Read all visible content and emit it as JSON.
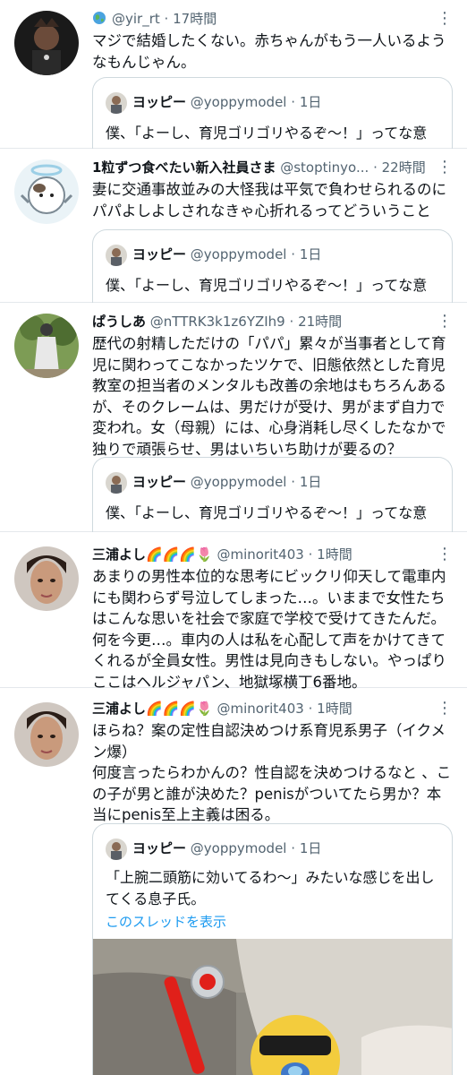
{
  "tweets": [
    {
      "author_name": "",
      "author_prefix_icon": "globe-icon",
      "handle": "@yir_rt",
      "time": "17時間",
      "text": "マジで結婚したくない。赤ちゃんがもう一人いるようなもんじゃん。",
      "quote": {
        "name": "ヨッピー",
        "handle": "@yoppymodel",
        "time": "1日",
        "text": "僕、「よーし、育児ゴリゴリやるぞ〜！」ってな意"
      }
    },
    {
      "author_name": "1粒ずつ食べたい新入社員さま",
      "handle": "@stoptinyo...",
      "time": "22時間",
      "text": "妻に交通事故並みの大怪我は平気で負わせられるのにパパよしよしされなきゃ心折れるってどういうこと",
      "quote": {
        "name": "ヨッピー",
        "handle": "@yoppymodel",
        "time": "1日",
        "text": "僕、「よーし、育児ゴリゴリやるぞ〜！」ってな意"
      }
    },
    {
      "author_name": "ぱうしあ",
      "handle": "@nTTRK3k1z6YZIh9",
      "time": "21時間",
      "text": "歴代の射精しただけの「パパ」累々が当事者として育児に関わってこなかったツケで、旧態依然とした育児教室の担当者のメンタルも改善の余地はもちろんあるが、そのクレームは、男だけが受け、男がまず自力で変われ。女（母親）には、心身消耗し尽くしたなかで独りで頑張らせ、男はいちいち助けが要るの？",
      "quote": {
        "name": "ヨッピー",
        "handle": "@yoppymodel",
        "time": "1日",
        "text": "僕、「よーし、育児ゴリゴリやるぞ〜！」ってな意"
      }
    },
    {
      "author_name": "三浦よし🌈🌈🌈🌷",
      "handle": "@minorit403",
      "time": "1時間",
      "text": "あまりの男性本位的な思考にビックリ仰天して電車内にも関わらず号泣してしまった…。いままで女性たちはこんな思いを社会で家庭で学校で受けてきたんだ。何を今更…。車内の人は私を心配して声をかけてきてくれるが全員女性。男性は見向きもしない。やっぱりここはヘルジャパン、地獄塚横丁6番地。"
    },
    {
      "author_name": "三浦よし🌈🌈🌈🌷",
      "handle": "@minorit403",
      "time": "1時間",
      "text": "ほらね？案の定性自認決めつけ系育児系男子（イクメン爆）\n何度言ったらわかんの？性自認を決めつけるなと 、この子が男と誰が決めた？penisがついてたら男か？本当にpenis至上主義は困る。",
      "quote": {
        "name": "ヨッピー",
        "handle": "@yoppymodel",
        "time": "1日",
        "text": "「上腕二頭筋に効いてるわ〜」みたいな感じを出してくる息子氏。",
        "thread_link": "このスレッドを表示"
      }
    }
  ],
  "separator": "·",
  "more_icon": "more-vertical-icon"
}
